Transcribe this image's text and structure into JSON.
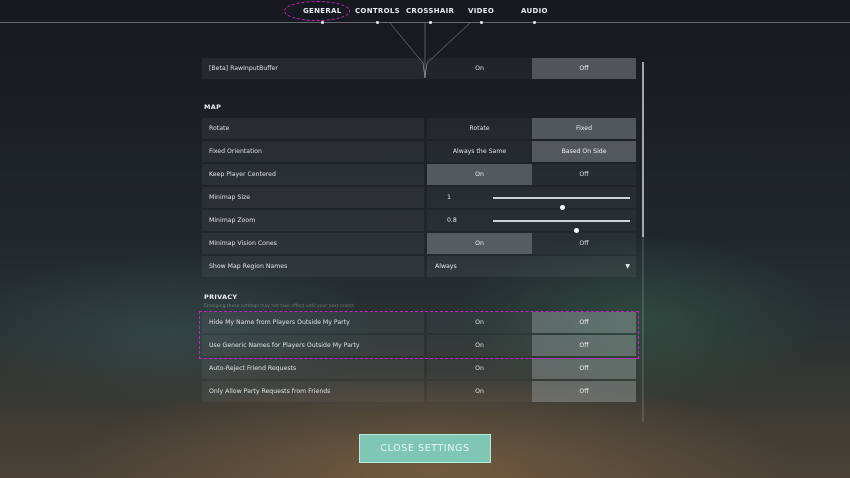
{
  "nav": {
    "tabs": [
      {
        "label": "GENERAL",
        "active": true
      },
      {
        "label": "CONTROLS",
        "active": false
      },
      {
        "label": "CROSSHAIR",
        "active": false
      },
      {
        "label": "VIDEO",
        "active": false
      },
      {
        "label": "AUDIO",
        "active": false
      }
    ]
  },
  "rows": {
    "raw_input": {
      "label": "[Beta] RawInputBuffer",
      "opt1": "On",
      "opt2": "Off",
      "selected": "Off"
    },
    "rotate": {
      "label": "Rotate",
      "opt1": "Rotate",
      "opt2": "Fixed",
      "selected": "Fixed"
    },
    "fixed_orientation": {
      "label": "Fixed Orientation",
      "opt1": "Always the Same",
      "opt2": "Based On Side",
      "selected": "Based On Side"
    },
    "keep_centered": {
      "label": "Keep Player Centered",
      "opt1": "On",
      "opt2": "Off",
      "selected": "On"
    },
    "minimap_size": {
      "label": "Minimap Size",
      "value": "1",
      "level": 0.51
    },
    "minimap_zoom": {
      "label": "Minimap Zoom",
      "value": "0.8",
      "level": 0.61
    },
    "vision_cones": {
      "label": "Minimap Vision Cones",
      "opt1": "On",
      "opt2": "Off",
      "selected": "On"
    },
    "region_names": {
      "label": "Show Map Region Names",
      "value": "Always"
    },
    "hide_name": {
      "label": "Hide My Name from Players Outside My Party",
      "opt1": "On",
      "opt2": "Off",
      "selected": "Off"
    },
    "generic_names": {
      "label": "Use Generic Names for Players Outside My Party",
      "opt1": "On",
      "opt2": "Off",
      "selected": "Off"
    },
    "auto_reject": {
      "label": "Auto-Reject Friend Requests",
      "opt1": "On",
      "opt2": "Off",
      "selected": "Off"
    },
    "party_requests": {
      "label": "Only Allow Party Requests from Friends",
      "opt1": "On",
      "opt2": "Off",
      "selected": "Off"
    }
  },
  "sections": {
    "map": "MAP",
    "privacy": "PRIVACY",
    "privacy_note": "Changing these settings may not take effect until your next match"
  },
  "close_button": "CLOSE SETTINGS",
  "colors": {
    "highlight": "#c822c8",
    "close_button": "#7fc6b4"
  }
}
